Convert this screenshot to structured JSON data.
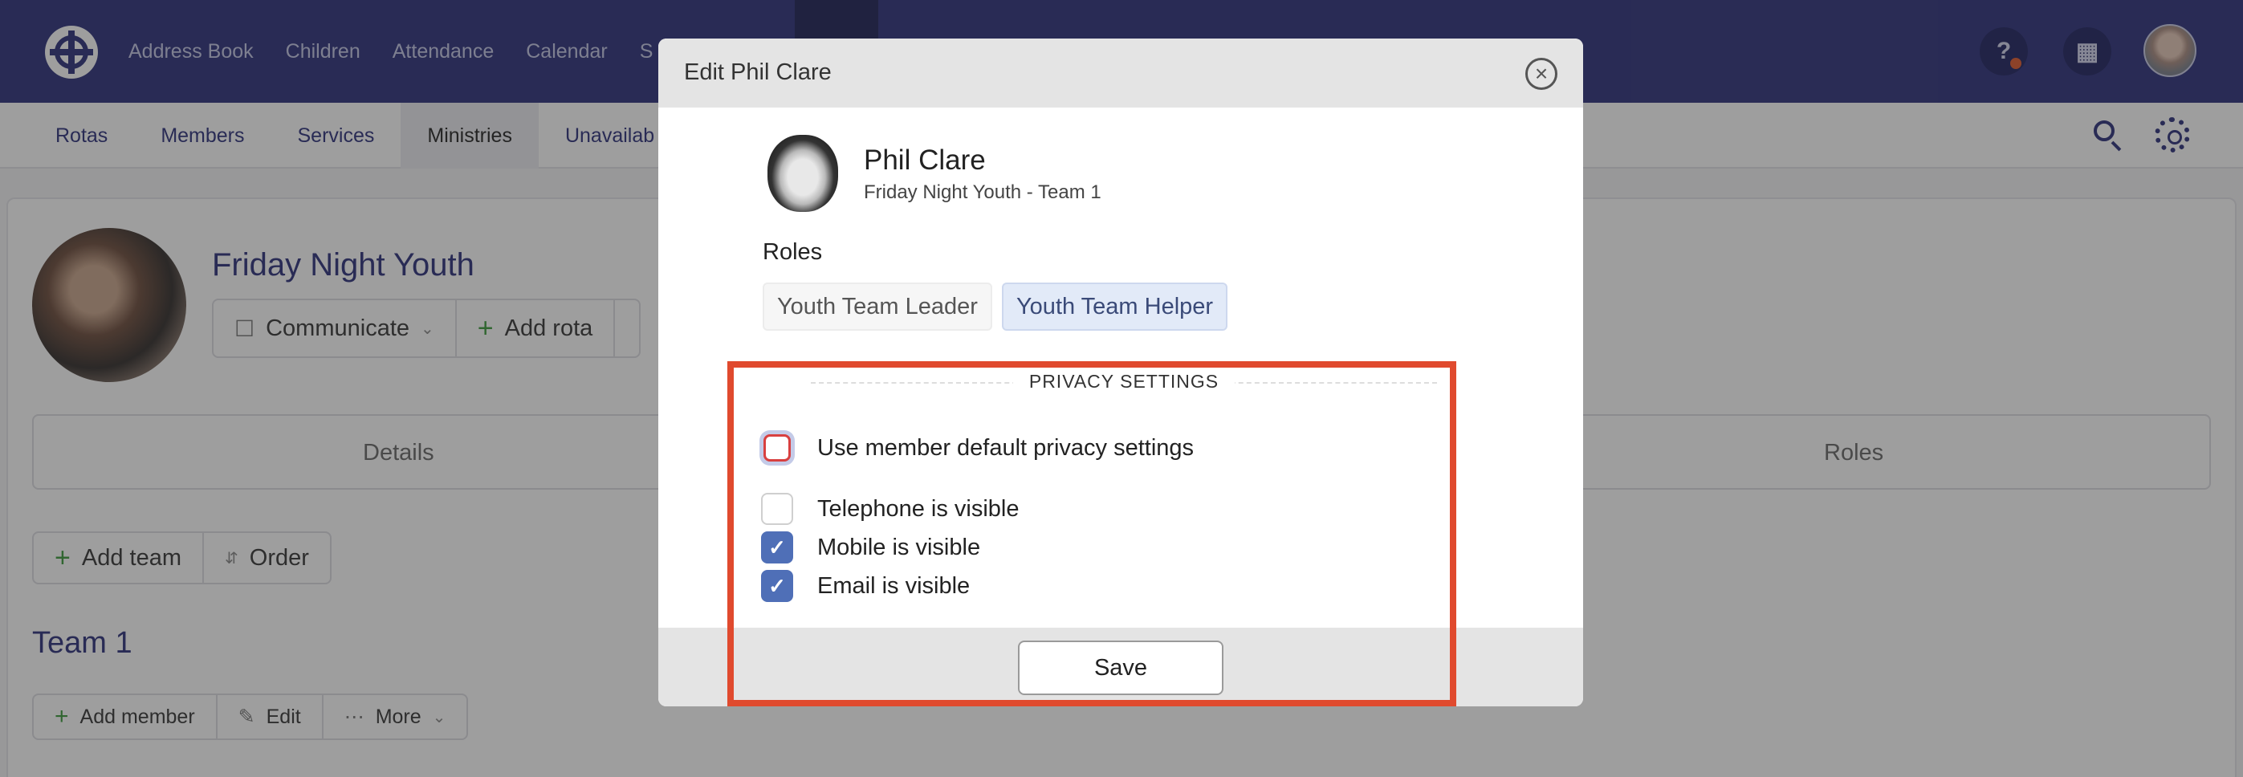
{
  "topnav": {
    "items": [
      "Address Book",
      "Children",
      "Attendance",
      "Calendar",
      "S"
    ],
    "help_icon": "question-circle-icon",
    "building_icon": "building-icon"
  },
  "subnav": {
    "items": [
      "Rotas",
      "Members",
      "Services",
      "Ministries",
      "Unavailab"
    ],
    "active": "Ministries"
  },
  "ministry": {
    "title": "Friday Night Youth",
    "actions": [
      "Communicate",
      "Add rota"
    ],
    "tabs": [
      "Details",
      "Roles"
    ],
    "team_actions": [
      "Add team",
      "Order"
    ],
    "team_title": "Team 1",
    "member_actions": [
      "Add member",
      "Edit",
      "More"
    ]
  },
  "modal": {
    "title": "Edit Phil Clare",
    "member_name": "Phil Clare",
    "member_subtitle": "Friday Night Youth - Team 1",
    "roles_label": "Roles",
    "roles": [
      {
        "label": "Youth Team Leader",
        "selected": false
      },
      {
        "label": "Youth Team Helper",
        "selected": true
      }
    ],
    "privacy_legend": "PRIVACY SETTINGS",
    "default_privacy": {
      "label": "Use member default privacy settings",
      "checked": false
    },
    "visibility": [
      {
        "label": "Telephone is visible",
        "checked": false
      },
      {
        "label": "Mobile is visible",
        "checked": true
      },
      {
        "label": "Email is visible",
        "checked": true
      }
    ],
    "save_label": "Save"
  },
  "colors": {
    "nav": "#2b2f7a",
    "checkbox": "#4f6fb7",
    "highlight": "#e04a2e"
  }
}
